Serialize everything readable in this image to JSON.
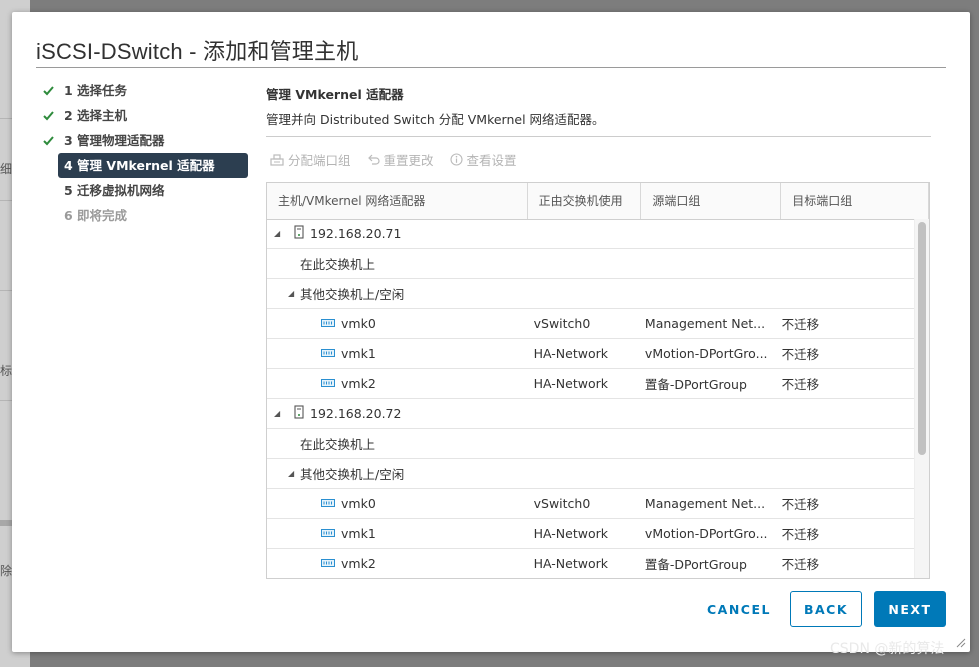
{
  "dialog": {
    "title": "iSCSI-DSwitch - 添加和管理主机"
  },
  "steps": [
    {
      "label": "1 选择任务",
      "state": "done"
    },
    {
      "label": "2 选择主机",
      "state": "done"
    },
    {
      "label": "3 管理物理适配器",
      "state": "done"
    },
    {
      "label": "4 管理 VMkernel 适配器",
      "state": "active"
    },
    {
      "label": "5 迁移虚拟机网络",
      "state": "pending"
    },
    {
      "label": "6 即将完成",
      "state": "disabled"
    }
  ],
  "section": {
    "title": "管理 VMkernel 适配器",
    "description": "管理并向 Distributed Switch 分配 VMkernel 网络适配器。"
  },
  "toolbar": {
    "assign": "分配端口组",
    "reset": "重置更改",
    "view": "查看设置"
  },
  "grid": {
    "columns": [
      "主机/VMkernel 网络适配器",
      "正由交换机使用",
      "源端口组",
      "目标端口组"
    ],
    "rows": [
      {
        "type": "host",
        "level": 0,
        "name": "192.168.20.71"
      },
      {
        "type": "group",
        "level": 1,
        "name": "在此交换机上"
      },
      {
        "type": "group-expanded",
        "level": 1,
        "name": "其他交换机上/空闲"
      },
      {
        "type": "vmk",
        "level": 2,
        "name": "vmk0",
        "switch": "vSwitch0",
        "source": "Management Net...",
        "target": "不迁移"
      },
      {
        "type": "vmk",
        "level": 2,
        "name": "vmk1",
        "switch": "HA-Network",
        "source": "vMotion-DPortGro...",
        "target": "不迁移"
      },
      {
        "type": "vmk",
        "level": 2,
        "name": "vmk2",
        "switch": "HA-Network",
        "source": "置备-DPortGroup",
        "target": "不迁移"
      },
      {
        "type": "host",
        "level": 0,
        "name": "192.168.20.72"
      },
      {
        "type": "group",
        "level": 1,
        "name": "在此交换机上"
      },
      {
        "type": "group-expanded",
        "level": 1,
        "name": "其他交换机上/空闲"
      },
      {
        "type": "vmk",
        "level": 2,
        "name": "vmk0",
        "switch": "vSwitch0",
        "source": "Management Net...",
        "target": "不迁移"
      },
      {
        "type": "vmk",
        "level": 2,
        "name": "vmk1",
        "switch": "HA-Network",
        "source": "vMotion-DPortGro...",
        "target": "不迁移"
      },
      {
        "type": "vmk",
        "level": 2,
        "name": "vmk2",
        "switch": "HA-Network",
        "source": "置备-DPortGroup",
        "target": "不迁移"
      }
    ]
  },
  "footer": {
    "cancel": "CANCEL",
    "back": "BACK",
    "next": "NEXT"
  },
  "background_fragments": [
    "细",
    "标",
    "除"
  ],
  "watermark": "CSDN @新的算法",
  "colors": {
    "primary": "#0079b8",
    "active_step_bg": "#2c3e50",
    "check_green": "#2e8b3c",
    "disabled_text": "#b4b4b4"
  }
}
